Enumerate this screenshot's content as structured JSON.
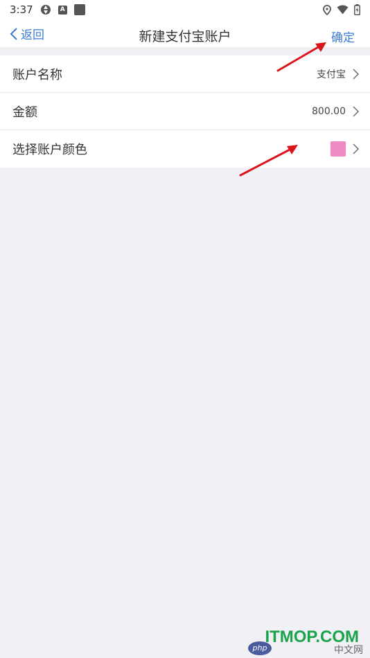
{
  "status_bar": {
    "time": "3:37"
  },
  "nav": {
    "back_label": "返回",
    "title": "新建支付宝账户",
    "confirm_label": "确定"
  },
  "rows": [
    {
      "label": "账户名称",
      "value": "支付宝"
    },
    {
      "label": "金额",
      "value": "800.00"
    },
    {
      "label": "选择账户颜色",
      "value": ""
    }
  ],
  "colors": {
    "accent": "#3a7bd5",
    "swatch": "#f08ac4",
    "arrow": "#d9141b"
  },
  "watermark": {
    "logo": "ITMOP.COM",
    "php": "php",
    "sub": "中文网"
  }
}
